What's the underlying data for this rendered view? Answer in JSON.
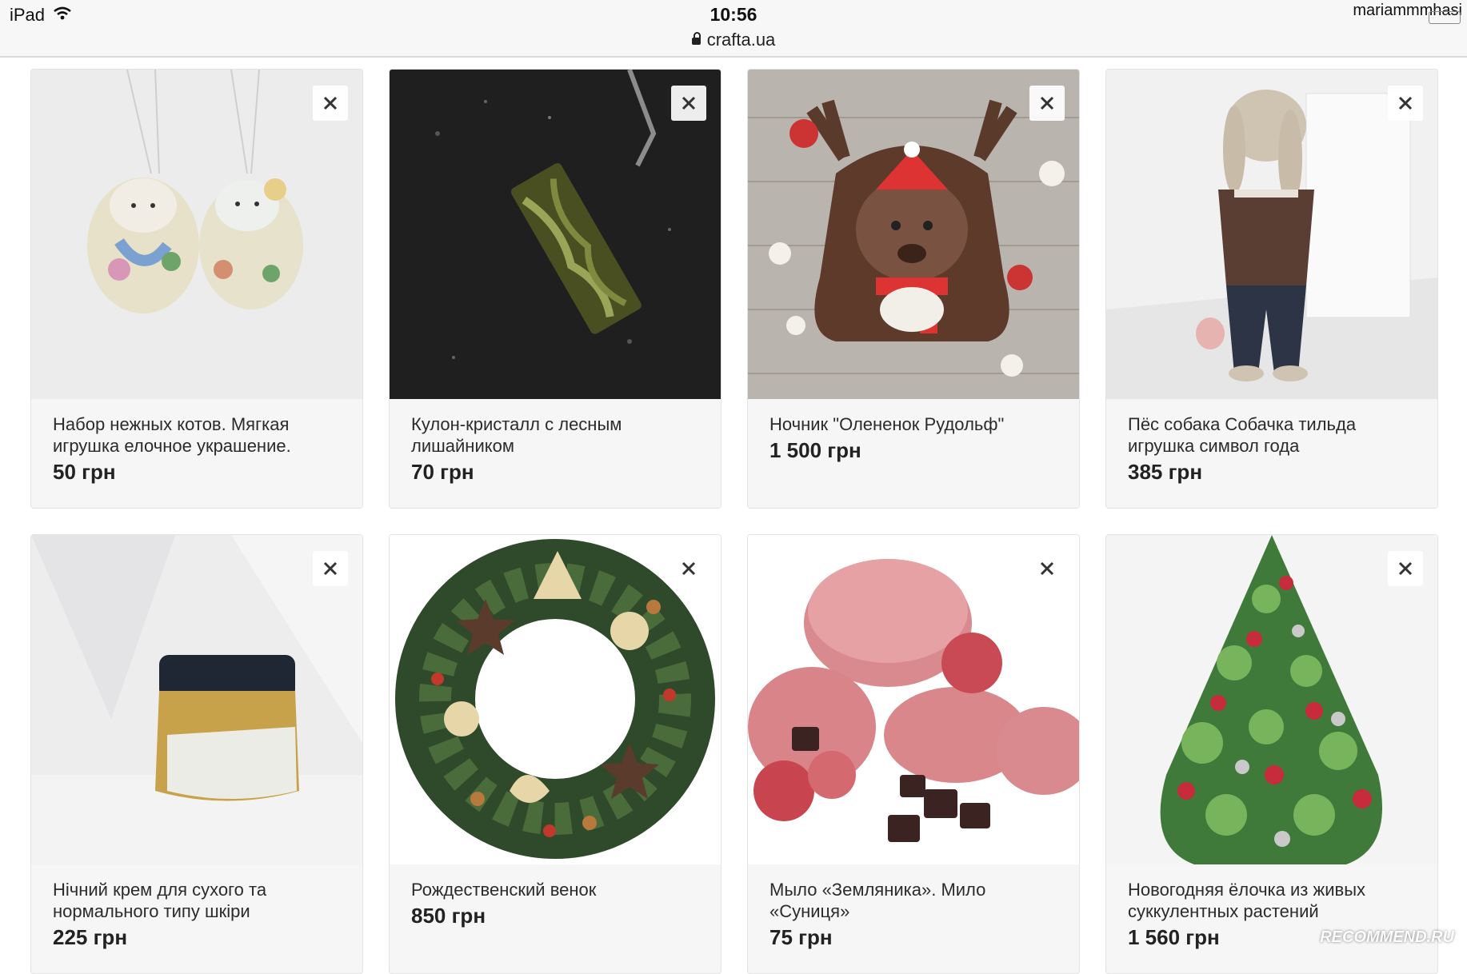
{
  "status_bar": {
    "device": "iPad",
    "time": "10:56",
    "url": "crafta.ua",
    "user": "mariammmhasi"
  },
  "products": [
    {
      "title": "Набор нежных котов. Мягкая игрушка елочное украшение.",
      "price": "50 грн"
    },
    {
      "title": "Кулон-кристалл с лесным лишайником",
      "price": "70 грн"
    },
    {
      "title": "Ночник \"Олененок Рудольф\"",
      "price": "1 500 грн"
    },
    {
      "title": "Пёс собака Собачка тильда игрушка символ года",
      "price": "385 грн"
    },
    {
      "title": "Нічний крем для сухого та нормального типу шкіри",
      "price": "225 грн"
    },
    {
      "title": "Рождественский венок",
      "price": "850 грн"
    },
    {
      "title": "Мыло «Земляника». Мило «Суниця»",
      "price": "75 грн"
    },
    {
      "title": "Новогодняя ёлочка из живых суккулентных растений",
      "price": "1 560 грн"
    }
  ],
  "watermark": "RECOMMEND.RU",
  "icons": {
    "close": "close-icon",
    "lock": "lock-icon",
    "wifi": "wifi-icon"
  }
}
